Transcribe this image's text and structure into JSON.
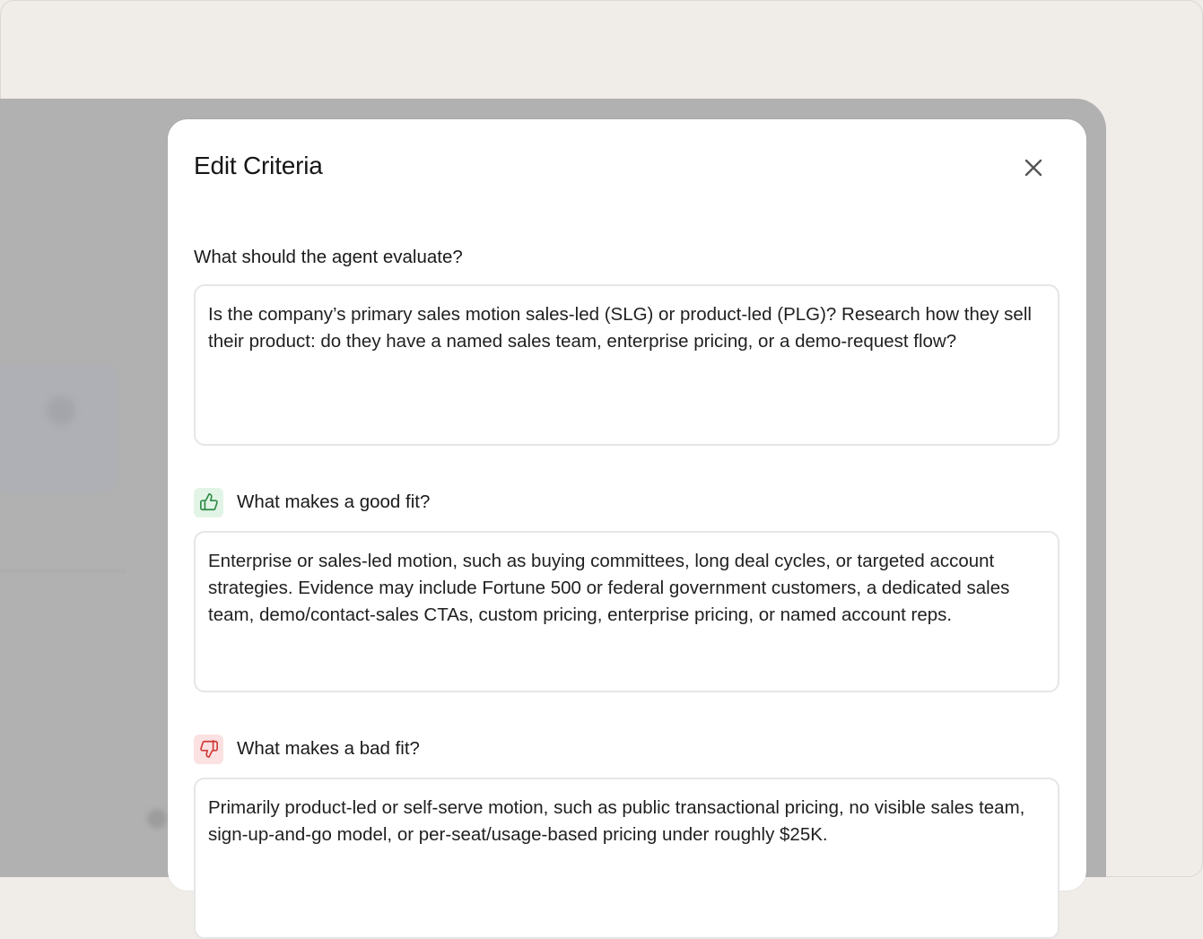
{
  "modal": {
    "title": "Edit Criteria",
    "close_icon": "close-icon"
  },
  "evaluate": {
    "label": "What should the agent evaluate?",
    "value": "Is the company’s primary sales motion sales-led (SLG) or product-led (PLG)? Research how they sell their product: do they have a named sales team, enterprise pricing, or a demo-request flow?"
  },
  "good_fit": {
    "label": "What makes a good fit?",
    "icon": "thumbs-up-icon",
    "icon_color": "#2e8b46",
    "icon_bg": "#e2f4e6",
    "value": "Enterprise or sales-led motion, such as buying committees, long deal cycles, or targeted account strategies. Evidence may include Fortune 500 or federal government customers, a dedicated sales team, demo/contact-sales CTAs, custom pricing, enterprise pricing, or named account reps."
  },
  "bad_fit": {
    "label": "What makes a bad fit?",
    "icon": "thumbs-down-icon",
    "icon_color": "#d03a3a",
    "icon_bg": "#fbe1e1",
    "value": "Primarily product-led or self-serve motion, such as public transactional pricing, no visible sales team, sign-up-and-go model, or per-seat/usage-based pricing under roughly $25K."
  }
}
